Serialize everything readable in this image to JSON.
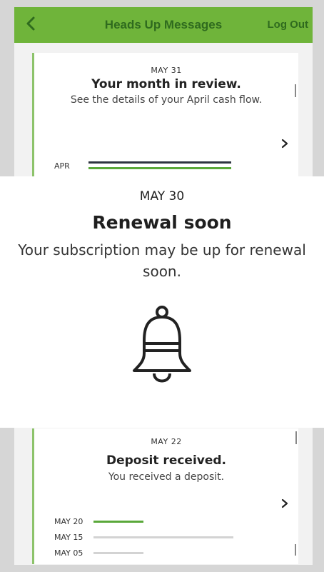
{
  "header": {
    "title": "Heads Up Messages",
    "logout_label": "Log Out"
  },
  "cards": {
    "top": {
      "date": "MAY 31",
      "title": "Your month in review.",
      "description": "See the details of your April cash flow.",
      "bar_label": "APR"
    },
    "bottom": {
      "date": "MAY 22",
      "title": "Deposit received.",
      "description": "You received a deposit.",
      "bars": [
        {
          "label": "MAY 20",
          "fraction": 0.35,
          "color": "#5aa83a"
        },
        {
          "label": "MAY 15",
          "fraction": 0.98,
          "color": "#d3d3d3"
        },
        {
          "label": "MAY 05",
          "fraction": 0.35,
          "color": "#d3d3d3"
        }
      ]
    }
  },
  "overlay": {
    "date": "MAY 30",
    "title": "Renewal soon",
    "description": "Your subscription may be up for renewal soon."
  },
  "colors": {
    "header_green": "#6fb43a",
    "accent_green": "#5aa83a",
    "dark_bar": "#2d3340"
  }
}
